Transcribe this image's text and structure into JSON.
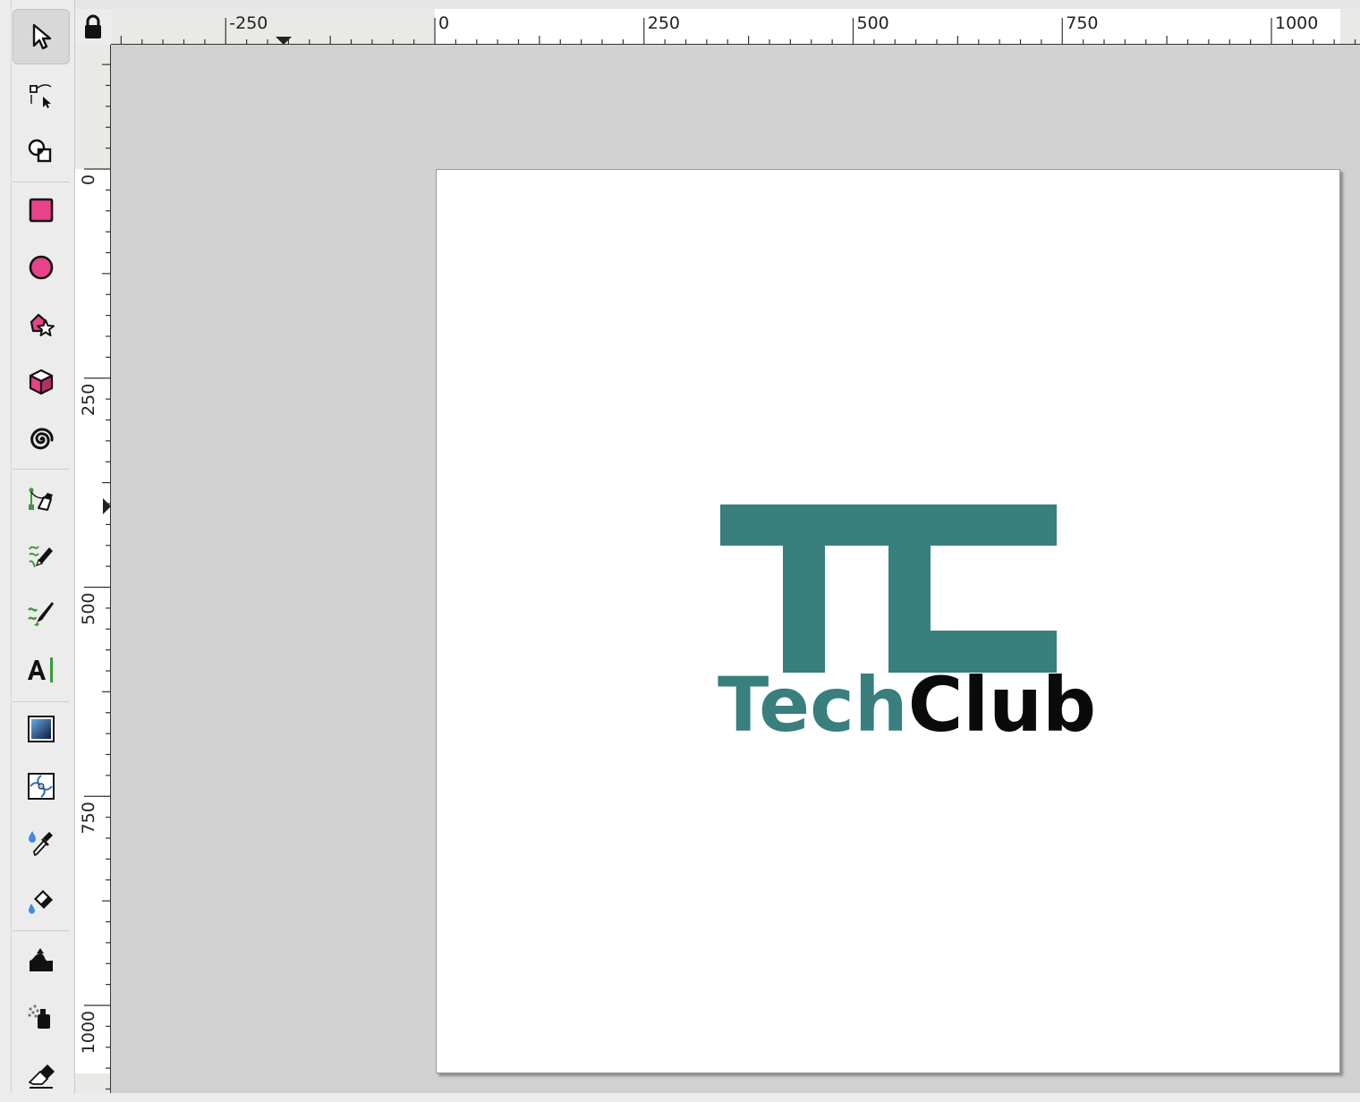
{
  "tools": [
    {
      "name": "selector-tool",
      "icon": "selector-arrow-icon",
      "active": true
    },
    {
      "name": "node-tool",
      "icon": "node-edit-icon"
    },
    {
      "name": "shape-builder-tool",
      "icon": "shape-builder-icon"
    },
    {
      "name": "rectangle-tool",
      "icon": "rectangle-icon"
    },
    {
      "name": "ellipse-tool",
      "icon": "ellipse-icon"
    },
    {
      "name": "star-polygon-tool",
      "icon": "star-polygon-icon"
    },
    {
      "name": "box3d-tool",
      "icon": "box3d-icon"
    },
    {
      "name": "spiral-tool",
      "icon": "spiral-icon"
    },
    {
      "name": "pen-tool",
      "icon": "pen-bezier-icon"
    },
    {
      "name": "pencil-tool",
      "icon": "pencil-icon"
    },
    {
      "name": "calligraphy-tool",
      "icon": "calligraphy-icon"
    },
    {
      "name": "text-tool",
      "icon": "text-icon"
    },
    {
      "name": "gradient-tool",
      "icon": "gradient-icon"
    },
    {
      "name": "mesh-tool",
      "icon": "mesh-icon"
    },
    {
      "name": "dropper-tool",
      "icon": "dropper-icon"
    },
    {
      "name": "paint-bucket-tool",
      "icon": "paint-bucket-icon"
    },
    {
      "name": "tweak-tool",
      "icon": "tweak-icon"
    },
    {
      "name": "spray-tool",
      "icon": "spray-icon"
    },
    {
      "name": "eraser-tool",
      "icon": "eraser-icon"
    }
  ],
  "rulers": {
    "horizontal_labels": [
      "-250",
      "0",
      "250",
      "500",
      "750",
      "1000"
    ],
    "vertical_labels": [
      "0",
      "250",
      "500",
      "750",
      "1000"
    ]
  },
  "logo": {
    "text_part1": "Tech",
    "text_part2": "Club",
    "primary_color": "#387f7e",
    "secondary_color": "#0a0a0a"
  },
  "colors": {
    "canvas_bg": "#d2d2d2",
    "page_bg": "#ffffff",
    "tool_accent": "#e8438a",
    "tool_green": "#3a9a3a"
  }
}
